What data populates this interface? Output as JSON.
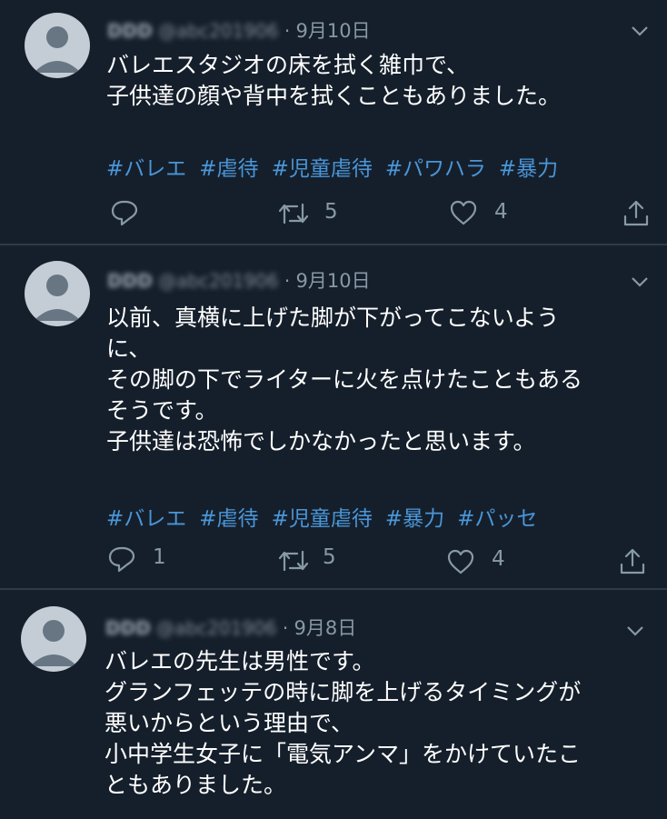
{
  "tweets": [
    {
      "name": "DDD",
      "handle": "@abc201906",
      "date": "9月10日",
      "text": "バレエスタジオの床を拭く雑巾で、\n子供達の顔や背中を拭くこともありました。",
      "hashtags": [
        "#バレエ",
        "#虐待",
        "#児童虐待",
        "#パワハラ",
        "#暴力"
      ],
      "reply_count": "",
      "retweet_count": "5",
      "like_count": "4"
    },
    {
      "name": "DDD",
      "handle": "@abc201906",
      "date": "9月10日",
      "text": "以前、真横に上げた脚が下がってこないよう\nに、\nその脚の下でライターに火を点けたこともある\nそうです。\n子供達は恐怖でしかなかったと思います。",
      "hashtags": [
        "#バレエ",
        "#虐待",
        "#児童虐待",
        "#暴力",
        "#パッセ"
      ],
      "reply_count": "1",
      "retweet_count": "5",
      "like_count": "4"
    },
    {
      "name": "DDD",
      "handle": "@abc201906",
      "date": "9月8日",
      "text": "バレエの先生は男性です。\nグランフェッテの時に脚を上げるタイミングが\n悪いからという理由で、\n小中学生女子に「電気アンマ」をかけていたこ\nともありました。"
    }
  ],
  "header_separator": "·",
  "icons": {
    "reply": "reply-icon",
    "retweet": "retweet-icon",
    "like": "like-icon",
    "share": "share-icon",
    "more": "chevron-down-icon",
    "avatar": "default-avatar-icon"
  },
  "colors": {
    "background": "#151f2b",
    "separator": "#2f3a47",
    "hashtag": "#4a96d8",
    "secondary_text": "#8899a6"
  }
}
